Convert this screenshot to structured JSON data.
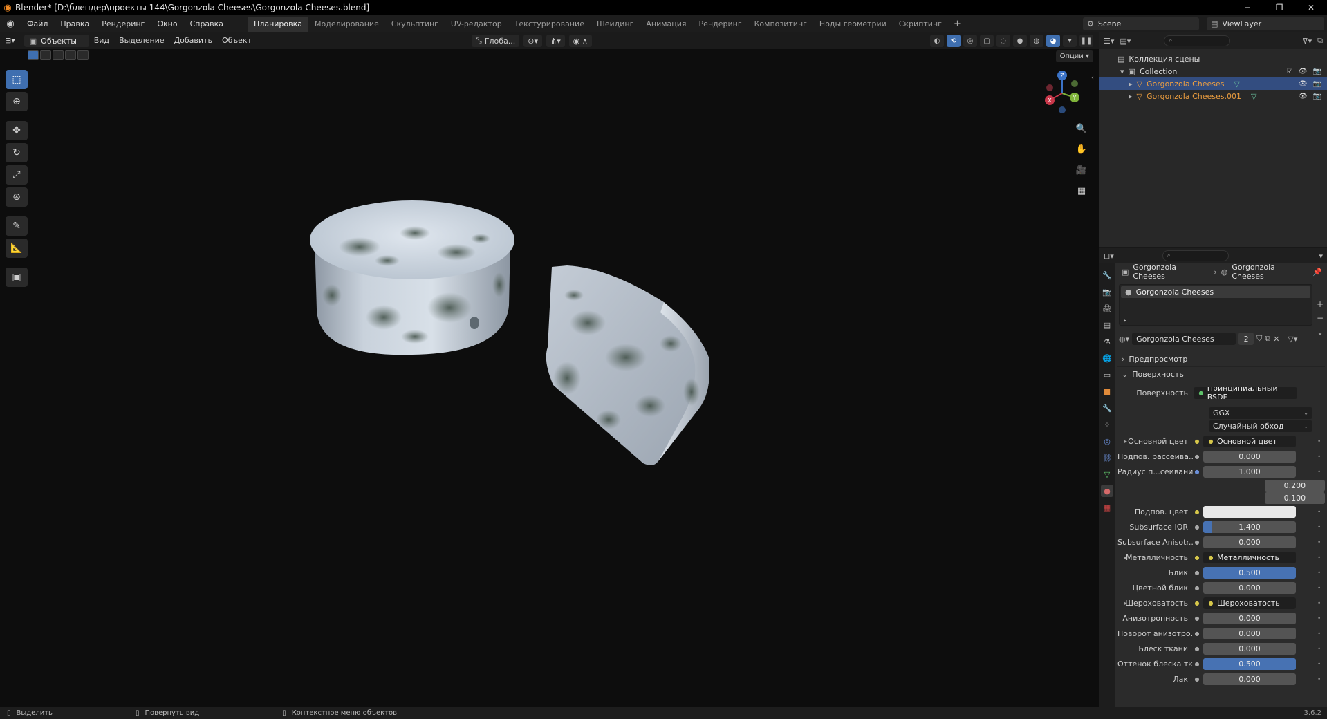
{
  "window": {
    "title": "Blender* [D:\\блендер\\проекты 144\\Gorgonzola Cheeses\\Gorgonzola Cheeses.blend]"
  },
  "menu": [
    "Файл",
    "Правка",
    "Рендеринг",
    "Окно",
    "Справка"
  ],
  "workspaces": [
    "Планировка",
    "Моделирование",
    "Скульптинг",
    "UV-редактор",
    "Текстурирование",
    "Шейдинг",
    "Анимация",
    "Рендеринг",
    "Композитинг",
    "Ноды геометрии",
    "Скриптинг"
  ],
  "active_workspace": "Планировка",
  "scene": {
    "name": "Scene"
  },
  "view_layer": {
    "name": "ViewLayer"
  },
  "viewport": {
    "mode": "Объекты",
    "menus": [
      "Вид",
      "Выделение",
      "Добавить",
      "Объект"
    ],
    "transform_orientation": "Глоба...",
    "options_label": "Опции",
    "gizmo_axes": {
      "x": "X",
      "y": "Y",
      "z": "Z"
    }
  },
  "outliner": {
    "root": "Коллекция сцены",
    "collection": "Collection",
    "objects": [
      {
        "name": "Gorgonzola Cheeses",
        "selected": true
      },
      {
        "name": "Gorgonzola Cheeses.001",
        "selected": false
      }
    ]
  },
  "properties": {
    "breadcrumb": [
      "Gorgonzola Cheeses",
      "Gorgonzola Cheeses"
    ],
    "material_slot": "Gorgonzola Cheeses",
    "material_name": "Gorgonzola Cheeses",
    "material_users": "2",
    "panels": {
      "preview": "Предпросмотр",
      "surface": "Поверхность"
    },
    "surface": {
      "label": "Поверхность",
      "shader": "Принципиальный BSDF",
      "distribution": "GGX",
      "subsurface_method": "Случайный обход"
    },
    "rows": [
      {
        "label": "Основной цвет",
        "value": "Основной цвет",
        "type": "link",
        "expand": true
      },
      {
        "label": "Подпов. рассеива...",
        "value": "0.000",
        "type": "num",
        "fill": 0
      },
      {
        "label": "Радиус п...сеивания",
        "value": "1.000",
        "type": "vec"
      },
      {
        "label": "",
        "value": "0.200",
        "type": "vec2"
      },
      {
        "label": "",
        "value": "0.100",
        "type": "vec2"
      },
      {
        "label": "Подпов. цвет",
        "value": "",
        "type": "color"
      },
      {
        "label": "Subsurface IOR",
        "value": "1.400",
        "type": "num",
        "fill": 0.1
      },
      {
        "label": "Subsurface Anisotr...",
        "value": "0.000",
        "type": "num",
        "fill": 0
      },
      {
        "label": "Металличность",
        "value": "Металличность",
        "type": "link",
        "expand": true
      },
      {
        "label": "Блик",
        "value": "0.500",
        "type": "num",
        "fill": 1
      },
      {
        "label": "Цветной блик",
        "value": "0.000",
        "type": "num",
        "fill": 0
      },
      {
        "label": "Шероховатость",
        "value": "Шероховатость",
        "type": "link",
        "expand": true
      },
      {
        "label": "Анизотропность",
        "value": "0.000",
        "type": "num",
        "fill": 0
      },
      {
        "label": "Поворот анизотро...",
        "value": "0.000",
        "type": "num",
        "fill": 0
      },
      {
        "label": "Блеск ткани",
        "value": "0.000",
        "type": "num",
        "fill": 0
      },
      {
        "label": "Оттенок блеска тк...",
        "value": "0.500",
        "type": "num",
        "fill": 1
      },
      {
        "label": "Лак",
        "value": "0.000",
        "type": "num",
        "fill": 0
      }
    ]
  },
  "statusbar": {
    "items": [
      "Выделить",
      "Повернуть вид",
      "Контекстное меню объектов"
    ],
    "version": "3.6.2"
  },
  "colors": {
    "accent": "#4772b3",
    "selection": "#334d80",
    "object_orange": "#f0a040",
    "viewport_bg": "#0d0d0d"
  }
}
